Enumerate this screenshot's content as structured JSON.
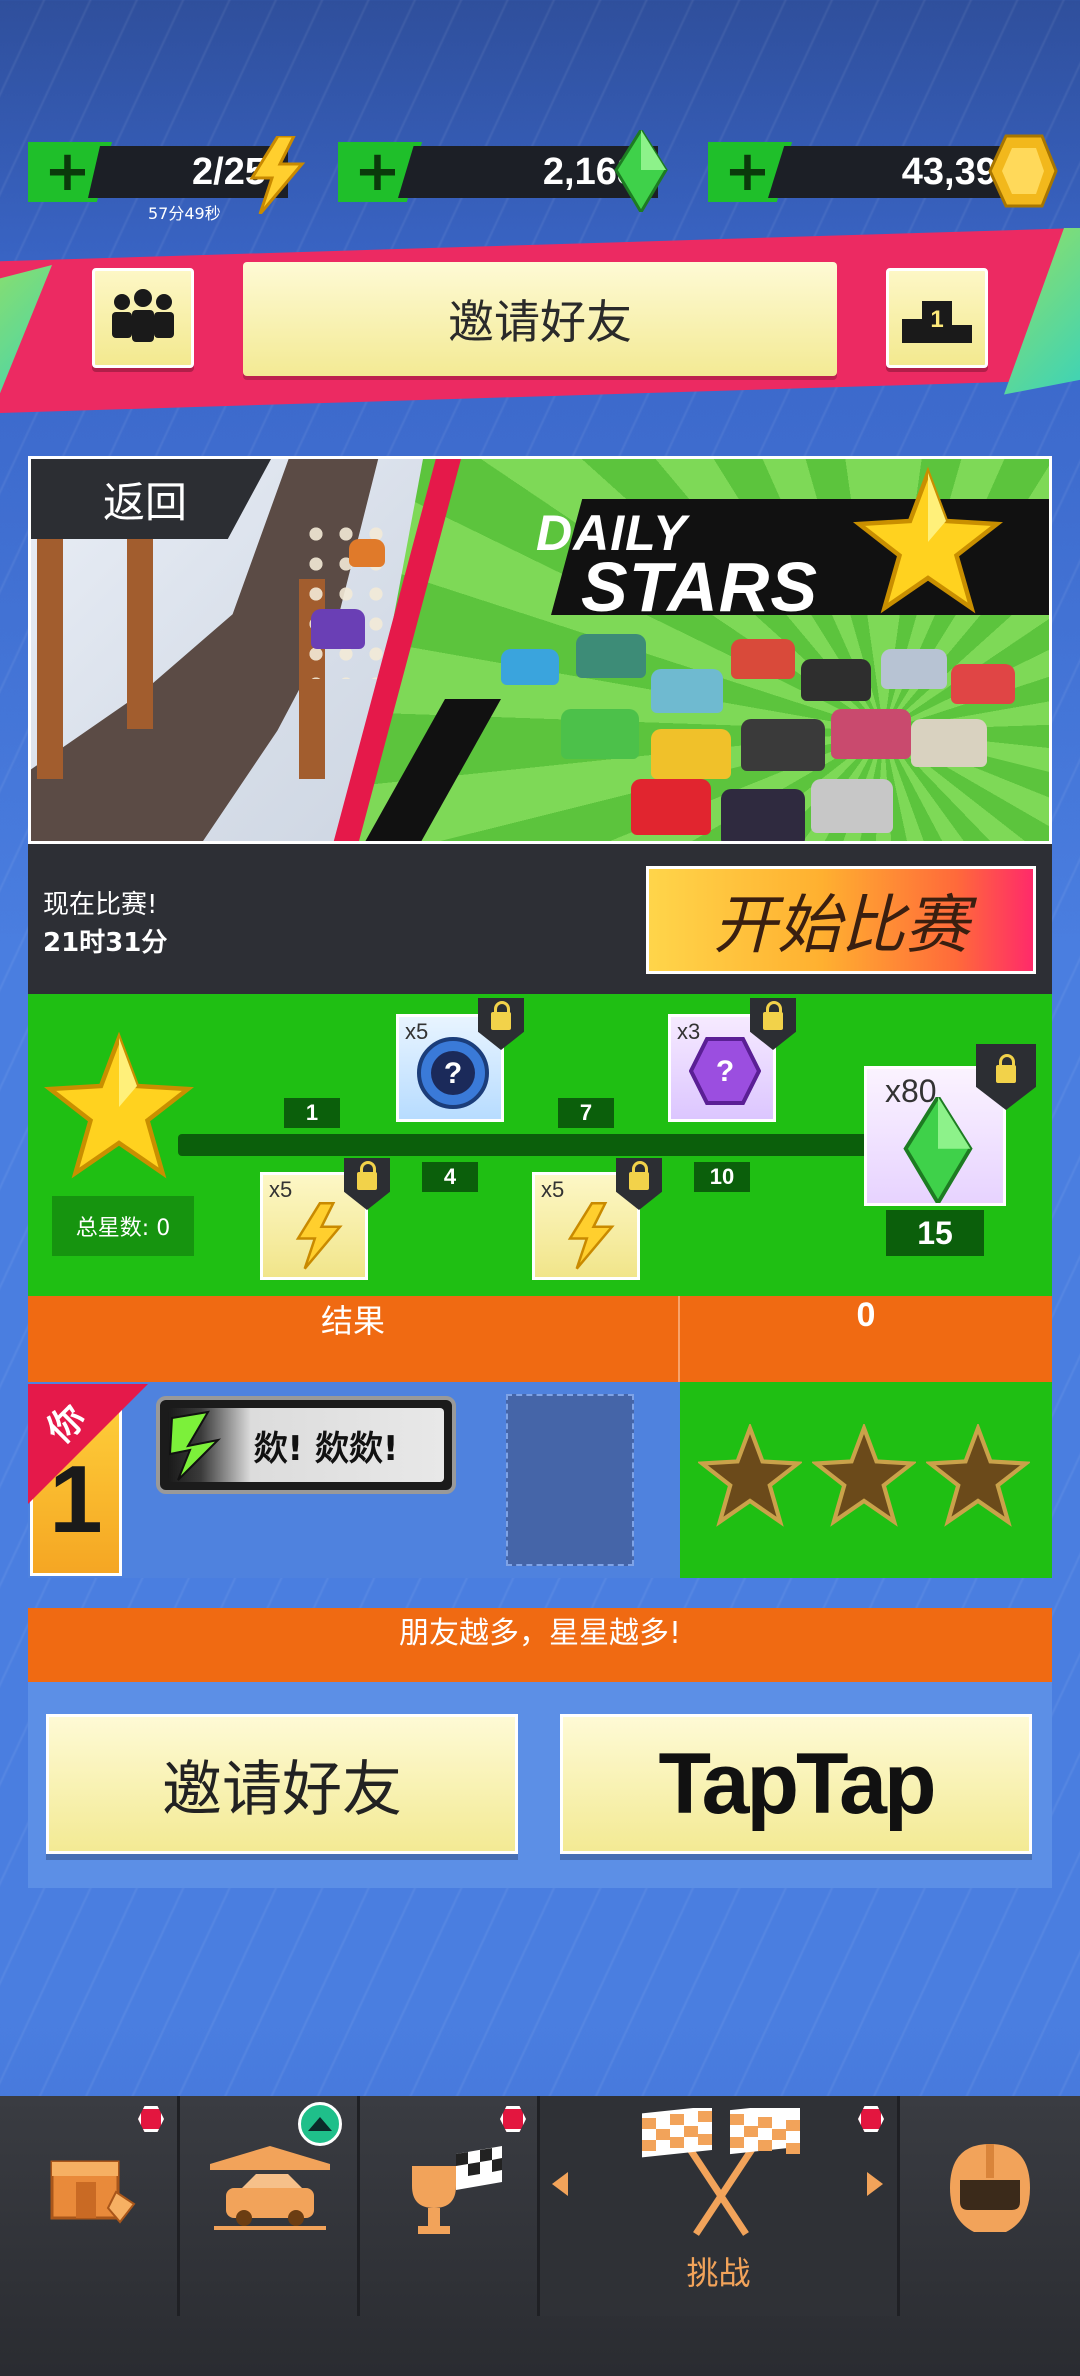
{
  "resources": {
    "energy": {
      "value": "2/25",
      "timer": "57分49秒"
    },
    "gems": {
      "value": "2,168"
    },
    "coins": {
      "value": "43,397"
    }
  },
  "header": {
    "invite_label": "邀请好友",
    "rank_badge": "1"
  },
  "banner": {
    "back_label": "返回",
    "title_line1": "DAILY",
    "title_line2": "STARS"
  },
  "race": {
    "status": "现在比赛!",
    "time_left": "21时31分",
    "start_label": "开始比赛"
  },
  "progress": {
    "total_stars_label": "总星数: 0",
    "milestones": [
      "1",
      "4",
      "7",
      "10"
    ],
    "goal": "15",
    "rewards": [
      {
        "count": "x5",
        "type": "lightning",
        "milestone": "1"
      },
      {
        "count": "x5",
        "type": "mystery-blue",
        "milestone": "4"
      },
      {
        "count": "x5",
        "type": "lightning",
        "milestone": "7"
      },
      {
        "count": "x3",
        "type": "mystery-purple",
        "milestone": "10"
      },
      {
        "count": "x80",
        "type": "gem",
        "milestone": "15"
      }
    ]
  },
  "results": {
    "header_label": "结果",
    "header_score": "0",
    "you_label": "你",
    "rank": "1",
    "plate_text": "欻! 欻欻!"
  },
  "tip": "朋友越多，星星越多!",
  "buttons": {
    "invite_label": "邀请好友",
    "taptap_label": "TapTap"
  },
  "nav": {
    "active_label": "挑战",
    "items": [
      "shop",
      "garage",
      "trophies",
      "challenge",
      "profile"
    ]
  },
  "colors": {
    "green": "#1fbf13",
    "orange": "#f06a12",
    "pink": "#ec2a62",
    "yellow_button": "#f3ea94"
  }
}
